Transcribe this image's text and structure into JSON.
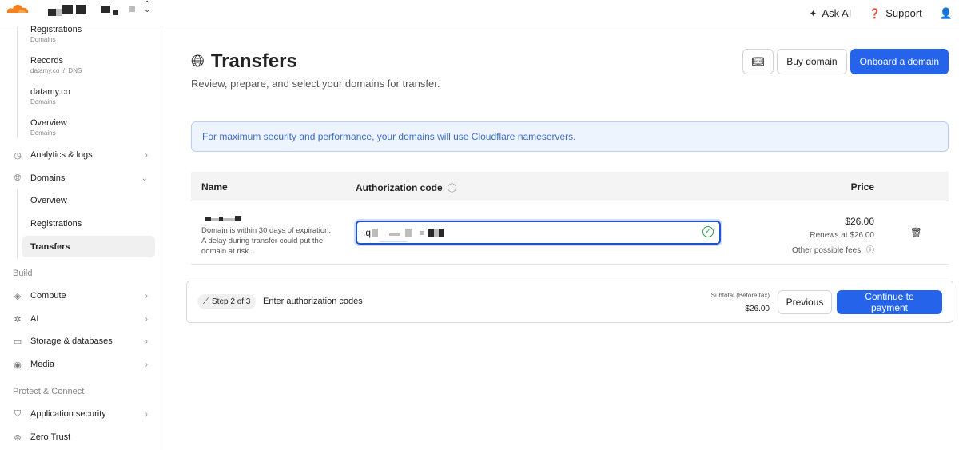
{
  "topbar": {
    "ask_ai": "Ask AI",
    "support": "Support",
    "icons": {
      "ask_ai": "sparkle-icon",
      "support": "help-circle-icon",
      "user": "user-icon",
      "account": "chevron-updown-icon"
    }
  },
  "sidebar": {
    "recent": [
      {
        "title": "Registrations",
        "sub": "Domains"
      },
      {
        "title": "Records",
        "sub": "datamy.co  /  DNS"
      },
      {
        "title": "datamy.co",
        "sub": "Domains"
      },
      {
        "title": "Overview",
        "sub": "Domains"
      }
    ],
    "analytics": "Analytics & logs",
    "domains": "Domains",
    "domains_sub": [
      "Overview",
      "Registrations",
      "Transfers"
    ],
    "build_label": "Build",
    "build": [
      "Compute",
      "AI",
      "Storage & databases",
      "Media"
    ],
    "protect_label": "Protect & Connect",
    "protect": [
      "Application security",
      "Zero Trust"
    ]
  },
  "main": {
    "title": "Transfers",
    "subtitle": "Review, prepare, and select your domains for transfer.",
    "buy_domain": "Buy domain",
    "onboard_domain": "Onboard a domain",
    "notice": "For maximum security and performance, your domains will use Cloudflare nameservers.",
    "table": {
      "col_name": "Name",
      "col_auth": "Authorization code",
      "col_price": "Price",
      "row": {
        "warning": "Domain is within 30 days of expiration. A delay during transfer could put the domain at risk.",
        "auth_value": ".q",
        "price": "$26.00",
        "renews": "Renews at $26.00",
        "other_fees": "Other possible fees"
      }
    },
    "footer": {
      "step": "Step 2 of 3",
      "step_desc": "Enter authorization codes",
      "subtotal_label": "Subtotal (Before tax)",
      "subtotal_value": "$26.00",
      "previous": "Previous",
      "continue": "Continue to payment"
    }
  },
  "colors": {
    "accent": "#2563eb",
    "brand": "#f38020",
    "notice_text": "#3b6cc4",
    "success": "#2aa24a"
  }
}
